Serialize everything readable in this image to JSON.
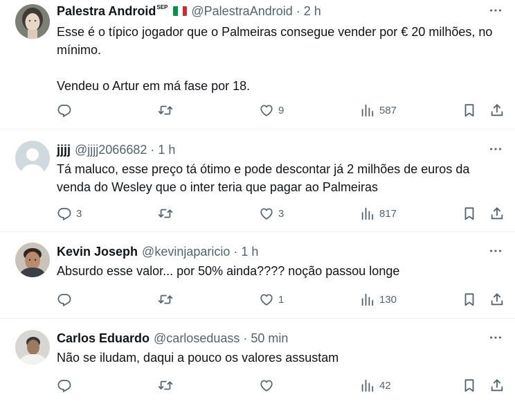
{
  "colors": {
    "text": "#0f1419",
    "muted": "#536471",
    "divider": "#eff3f4",
    "flag_green": "#009246",
    "flag_white": "#ffffff",
    "flag_red": "#ce2b37"
  },
  "icons": {
    "reply": "reply-icon",
    "retweet": "retweet-icon",
    "like": "heart-icon",
    "views": "bar-chart-icon",
    "bookmark": "bookmark-icon",
    "share": "share-icon",
    "more": "more-icon"
  },
  "tweets": [
    {
      "name": "Palestra Android",
      "name_sup": "SEP",
      "handle": "@PalestraAndroid",
      "time": "2 h",
      "text": "Esse é o típico jogador que o Palmeiras consegue vender por € 20 milhões, no mínimo.\n\nVendeu o Artur em má fase por 18.",
      "replies": "",
      "retweets": "",
      "likes": "9",
      "views": "587"
    },
    {
      "name": "jjjj",
      "handle": "@jjjj2066682",
      "time": "1 h",
      "text": "Tá maluco, esse preço tá ótimo e pode descontar já 2 milhões de euros da venda do Wesley que o inter teria que pagar ao Palmeiras",
      "replies": "3",
      "retweets": "",
      "likes": "3",
      "views": "817"
    },
    {
      "name": "Kevin Joseph",
      "handle": "@kevinjaparicio",
      "time": "1 h",
      "text": "Absurdo esse valor... por 50% ainda???? noção passou longe",
      "replies": "",
      "retweets": "",
      "likes": "1",
      "views": "130"
    },
    {
      "name": "Carlos Eduardo",
      "handle": "@carloseduass",
      "time": "50 min",
      "text": "Não se iludam, daqui a pouco os valores assustam",
      "replies": "",
      "retweets": "",
      "likes": "",
      "views": "42"
    }
  ]
}
